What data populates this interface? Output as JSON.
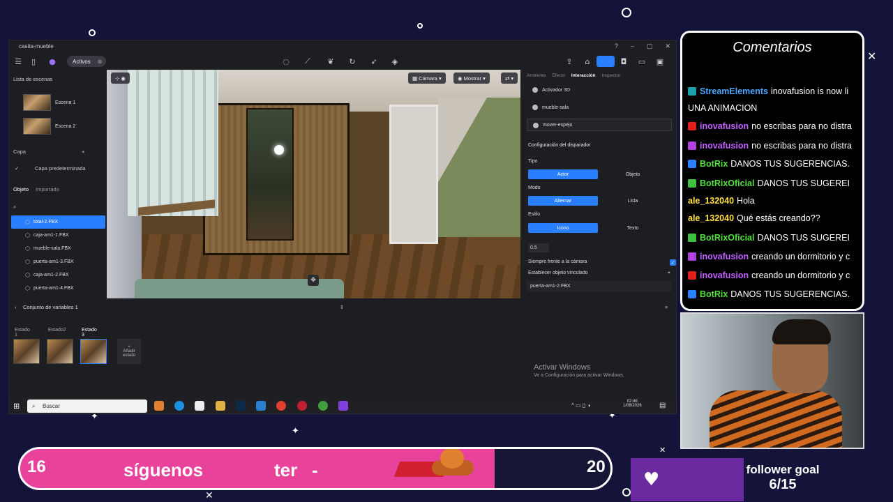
{
  "app": {
    "title": "casita-mueble",
    "toolbar": {
      "assets_label": "Activos"
    },
    "scenes": {
      "header": "Lista de escenas",
      "items": [
        "Escena 1",
        "Escena 2"
      ]
    },
    "layers": {
      "header": "Capa",
      "default_layer": "Capa predeterminada"
    },
    "object_tabs": {
      "object": "Objeto",
      "imported": "Importado"
    },
    "objects": [
      "total-2.FBX",
      "caja-am1-1.FBX",
      "mueble-sala.FBX",
      "puerta-am1-3.FBX",
      "caja-am1-2.FBX",
      "puerta-am1-4.FBX"
    ],
    "viewport": {
      "camera_label": "Cámara",
      "show_label": "Mostrar"
    },
    "right_tabs": [
      "Ambiente",
      "Efecto",
      "Interacción",
      "Inspector"
    ],
    "right_items": [
      "Activador 3D",
      "mueble-sala",
      "mover-espejo"
    ],
    "trigger": {
      "header": "Configuración del disparador",
      "tipo_label": "Tipo",
      "tipo_options": [
        "Actor",
        "Objeto"
      ],
      "modo_label": "Modo",
      "modo_options": [
        "Alternar",
        "Lista"
      ],
      "estilo_label": "Estilo",
      "estilo_options": [
        "Icono",
        "Texto"
      ],
      "value": "0.5",
      "face_camera": "Siempre frente a la cámara",
      "linked_label": "Establecer objeto vinculado",
      "linked_value": "puerta-am1-2.FBX"
    },
    "variables_label": "Conjunto de variables 1",
    "states": [
      "Estado 1",
      "Estado2",
      "Estado 3"
    ],
    "add_state": "Añadir estado",
    "activate_title": "Activar Windows",
    "activate_sub": "Ve a Configuración para activar Windows.",
    "taskbar": {
      "search": "Buscar",
      "time": "02:46",
      "date": "1/08/2026"
    }
  },
  "chat": {
    "title": "Comentarios",
    "messages": [
      {
        "user": "StreamElements",
        "text": "inovafusion is now li",
        "color": "#4aa6ff",
        "icon": "#1aa0a8"
      },
      {
        "user": "",
        "text": "UNA ANIMACION",
        "color": "#ffffff",
        "icon": ""
      },
      {
        "user": "inovafusion",
        "text": "no escribas para no distra",
        "color": "#c060ff",
        "icon": "#e02020"
      },
      {
        "user": "inovafusion",
        "text": "no escribas para no distra",
        "color": "#c060ff",
        "icon": "#b040e0"
      },
      {
        "user": "BotRix",
        "text": "DANOS TUS SUGERENCIAS.",
        "color": "#54e040",
        "icon": "#2a80ff"
      },
      {
        "user": "BotRixOficial",
        "text": "DANOS TUS SUGEREI",
        "color": "#54e040",
        "icon": "#40c040"
      },
      {
        "user": "ale_132040",
        "text": "Hola",
        "color": "#ffe040",
        "icon": ""
      },
      {
        "user": "ale_132040",
        "text": "Qué estás creando??",
        "color": "#ffe040",
        "icon": ""
      },
      {
        "user": "BotRixOficial",
        "text": "DANOS TUS SUGEREI",
        "color": "#54e040",
        "icon": "#40c040"
      },
      {
        "user": "inovafusion",
        "text": "creando un dormitorio y c",
        "color": "#c060ff",
        "icon": "#b040e0"
      },
      {
        "user": "inovafusion",
        "text": "creando un dormitorio y c",
        "color": "#c060ff",
        "icon": "#e02020"
      },
      {
        "user": "BotRix",
        "text": "DANOS TUS SUGERENCIAS.",
        "color": "#54e040",
        "icon": "#2a80ff"
      }
    ]
  },
  "overlay": {
    "left_count": "16",
    "follow_text": "síguenos",
    "scroll_text": "ter",
    "dash": "-",
    "right_count": "20",
    "goal_label": "follower goal",
    "goal_progress": "6/15"
  },
  "colors": {
    "accent": "#2a7fff",
    "bar_pink": "#e8429a",
    "goal_purple": "#6a2aa0",
    "bg": "#14133a"
  }
}
